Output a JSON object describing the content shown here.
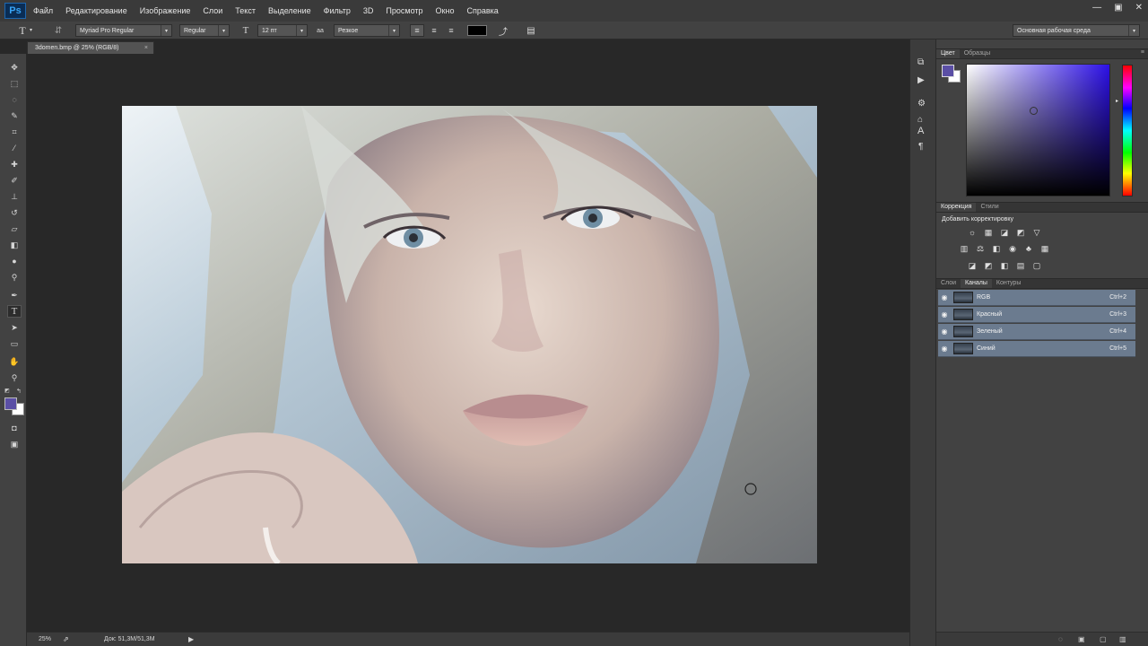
{
  "app": {
    "logo": "Ps"
  },
  "menu": [
    "Файл",
    "Редактирование",
    "Изображение",
    "Слои",
    "Текст",
    "Выделение",
    "Фильтр",
    "3D",
    "Просмотр",
    "Окно",
    "Справка"
  ],
  "window_controls": [
    "minimize-icon",
    "restore-icon",
    "close-icon"
  ],
  "options_bar": {
    "font_family": "Myriad Pro Regular",
    "font_style": "Regular",
    "font_size": "12 пт",
    "aa_icon": "aa",
    "antialias": "Резкое",
    "text_color": "#000000",
    "workspace": "Основная рабочая среда"
  },
  "document": {
    "tab_title": "3domen.bmp @ 25% (RGB/8)",
    "close": "×"
  },
  "status": {
    "zoom": "25%",
    "doc_info": "Док: 51,3M/51,3M"
  },
  "colors": {
    "foreground": "#5b4fa5",
    "background": "#ffffff",
    "hue_picker": "#2c10e6"
  },
  "panels": {
    "color_tabs": [
      "Цвет",
      "Образцы"
    ],
    "adjust_tabs": [
      "Коррекция",
      "Стили"
    ],
    "adjust_title": "Добавить корректировку",
    "layers_tabs": [
      "Слои",
      "Каналы",
      "Контуры"
    ],
    "channels": [
      {
        "name": "RGB",
        "shortcut": "Ctrl+2"
      },
      {
        "name": "Красный",
        "shortcut": "Ctrl+3"
      },
      {
        "name": "Зеленый",
        "shortcut": "Ctrl+4"
      },
      {
        "name": "Синий",
        "shortcut": "Ctrl+5"
      }
    ]
  },
  "tools": [
    "move-tool",
    "marquee-tool",
    "lasso-tool",
    "quick-select-tool",
    "crop-tool",
    "eyedropper-tool",
    "healing-brush-tool",
    "brush-tool",
    "clone-stamp-tool",
    "history-brush-tool",
    "eraser-tool",
    "gradient-tool",
    "blur-tool",
    "dodge-tool",
    "pen-tool",
    "type-tool",
    "path-select-tool",
    "shape-tool",
    "hand-tool",
    "zoom-tool"
  ]
}
